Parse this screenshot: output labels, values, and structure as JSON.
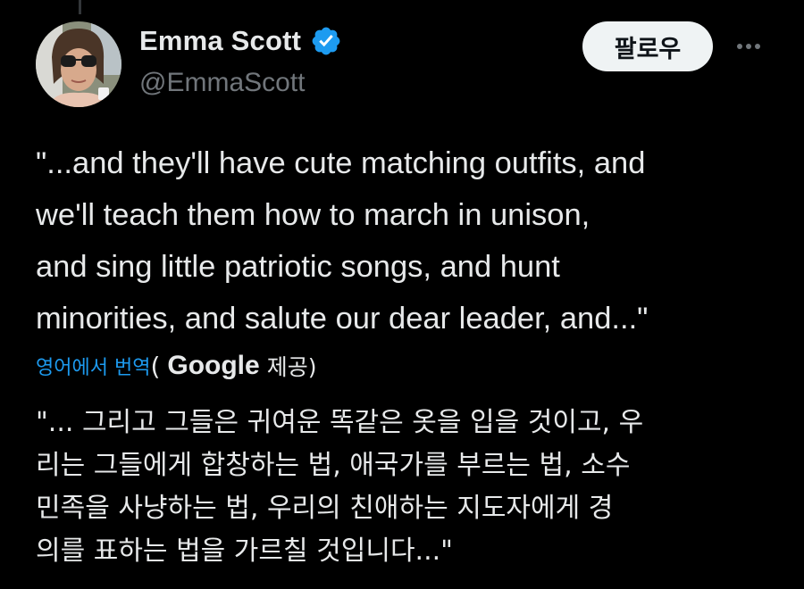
{
  "author": {
    "display_name": "Emma Scott",
    "handle": "@EmmaScott",
    "verified_badge_color": "#1d9bf0"
  },
  "actions": {
    "follow_label": "팔로우",
    "more_icon": "more-horizontal-icon"
  },
  "tweet": {
    "text": "\"...and they'll have cute matching outfits, and\nwe'll teach them how to march in unison,\nand sing little patriotic songs, and hunt\nminorities, and salute our dear leader, and...\""
  },
  "translation": {
    "link_label": "영어에서 번역",
    "open_paren": "(",
    "provider": "Google",
    "provided_label": "제공)",
    "text": "\"... 그리고 그들은 귀여운 똑같은 옷을 입을 것이고, 우\n리는 그들에게 합창하는 법, 애국가를 부르는 법, 소수\n민족을 사냥하는 법, 우리의 친애하는 지도자에게 경\n의를 표하는 법을 가르칠 것입니다...\""
  },
  "colors": {
    "background": "#000000",
    "text": "#e7e9ea",
    "secondary": "#71767b",
    "link": "#1d9bf0"
  }
}
